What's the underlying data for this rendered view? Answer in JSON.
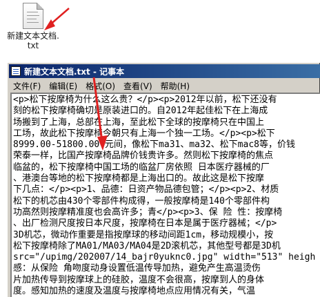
{
  "desktop": {
    "file_icon": {
      "icon": "text-file-icon",
      "label": "新建文本文档.txt"
    }
  },
  "window": {
    "title": "新建文本文档.txt - 记事本",
    "app_icon": "notepad-icon",
    "menu": [
      "文件(F)",
      "编辑(E)",
      "格式(O)",
      "查看(V)",
      "帮助(H)"
    ],
    "lines": [
      "<p>松下按摩椅为什么这么贵？</p><p>2012年以前，松下还没有",
      "刻的松下按摩椅确切是原装进口的。自2012年起佳松下在上海成",
      "场搬到了上海，总部在上海，至此松下全球的按摩椅只在中国上",
      "工场，故此松下按摩椅今朝只有上海一个独一工场。</p><p>松下",
      "8999.00-51800.00 元间，像松下ma31、ma32、松下mac8等，价钱",
      "荣泰一样，比国产按摩椅品牌价钱贵许多。然则松下按摩椅的焦点",
      "临盆的，松下按摩椅中国工场的临盆厂房依照 日本医疗器械的厂",
      "、港澳台等地的松下按摩椅都是上海出口的。故此这是松下按摩",
      "下几点：</p><p>1、品德：日资产物品德包管；</p><p>2、材质",
      "松下的机芯由430个零部件构成得，一般按摩椅是140个零部件构",
      "功高然则按摩精准度也会高许多；青</p><p>3、保 险 性：按摩椅",
      "、出厂检测尺度按日本尺度，按摩椅在日本是属于医疗器械；</p>",
      "3D机芯，微动作重要是指按摩球的移动间距1cm，移动规模小，按",
      "松下按摩椅除了MA01/MA03/MA04是2D滚机芯，其他型号都是3D机",
      "src=\"/upimg/202007/14_bajr0yuknc0.jpg\" width=\"513\" heigh",
      "感：从保险 角吻度动身设置低温传导加热，避免产生高温烫伤",
      "片加热传导到按摩球上的硅胶，温度不会很高，按摩到人的身体",
      "度。感知加热的速度及温度与按摩椅地点应用情况有关，气温"
    ]
  },
  "annotation_color": "#e02020"
}
